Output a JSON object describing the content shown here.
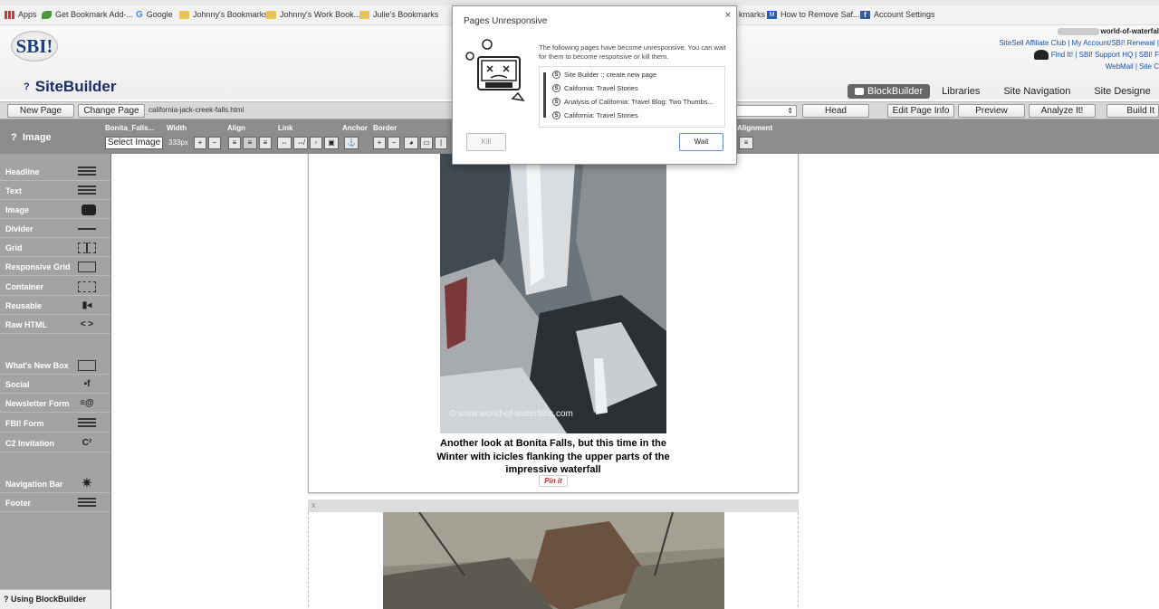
{
  "bookmarks": [
    {
      "label": "Apps",
      "icon": "apps-icon"
    },
    {
      "label": "Get Bookmark Add-...",
      "icon": "leaf-icon"
    },
    {
      "label": "Google",
      "icon": "google-icon"
    },
    {
      "label": "Johnny's Bookmarks",
      "icon": "folder-icon"
    },
    {
      "label": "Johnny's Work Book...",
      "icon": "folder-icon"
    },
    {
      "label": "Julie's Bookmarks",
      "icon": "folder-icon"
    },
    {
      "label": "kmarks",
      "icon": "folder-icon"
    },
    {
      "label": "How to Remove Saf...",
      "icon": "mt-icon"
    },
    {
      "label": "Account Settings",
      "icon": "facebook-icon"
    }
  ],
  "header": {
    "logo": "SBI!",
    "title": "SiteBuilder",
    "site_name": "world-of-waterfal",
    "links_row1": "SiteSell Affiliate Club | My Account/SBI! Renewal |",
    "links_row2": "Find It! | SBI! Support HQ | SBI! F",
    "links_row3": "WebMail | Site C"
  },
  "nav_tabs": [
    "BlockBuilder",
    "Libraries",
    "Site Navigation",
    "Site Designe"
  ],
  "button_bar": {
    "new_page": "New Page",
    "change_page": "Change Page",
    "filename": "california-jack-creek-falls.html",
    "head": "Head",
    "edit_page_info": "Edit Page Info",
    "preview": "Preview",
    "analyze": "Analyze It!",
    "build": "Build It"
  },
  "toolbar": {
    "title": "Image",
    "groups": [
      "Bonita_Falls...",
      "Width",
      "Align",
      "Link",
      "Anchor",
      "Border",
      "Alignment"
    ],
    "select_image": "Select Image",
    "width_value": "333px"
  },
  "sidebar": {
    "items": [
      "Headline",
      "Text",
      "Image",
      "Divider",
      "Grid",
      "Responsive Grid",
      "Container",
      "Reusable",
      "Raw HTML",
      "What's New Box",
      "Social",
      "Newsletter Form",
      "FBI! Form",
      "C2 Invitation",
      "Navigation Bar",
      "Footer"
    ],
    "footer": "Using BlockBuilder"
  },
  "canvas": {
    "watermark": "© www.world-of-waterfalls.com",
    "caption": "Another look at Bonita Falls, but this time in the Winter with icicles flanking the upper parts of the impressive waterfall",
    "pinit": "Pin it",
    "block2_close": "x"
  },
  "dialog": {
    "title": "Pages Unresponsive",
    "close": "×",
    "message": "The following pages have become unresponsive. You can wait for them to become responsive or kill them.",
    "pages": [
      "Site Builder :: create new page",
      "California: Travel Stories",
      "Analysis of California: Travel Blog: Two Thumbs...",
      "California: Travel Stories"
    ],
    "kill": "Kill",
    "wait": "Wait"
  }
}
